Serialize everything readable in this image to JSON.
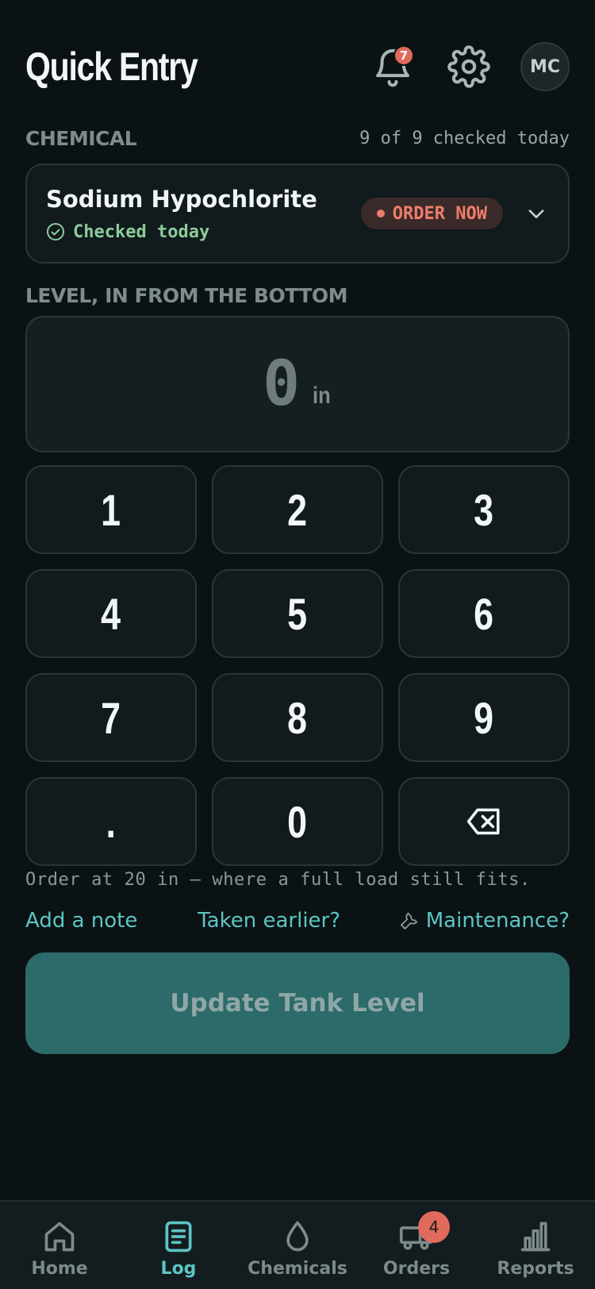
{
  "header": {
    "title": "Quick Entry",
    "notifications_count": "7",
    "avatar_initials": "MC",
    "icons": [
      "bell-icon",
      "gear-icon"
    ]
  },
  "chemical_section": {
    "label": "CHEMICAL",
    "checked_summary": "9 of 9 checked today",
    "selected": {
      "name": "Sodium Hypochlorite",
      "status": "Checked today",
      "order_badge": "ORDER NOW"
    }
  },
  "level_section": {
    "label": "LEVEL, IN FROM THE BOTTOM",
    "value": "0",
    "unit": "in"
  },
  "keypad": {
    "keys": [
      "1",
      "2",
      "3",
      "4",
      "5",
      "6",
      "7",
      "8",
      "9",
      ".",
      "0"
    ],
    "backspace_icon": "backspace-icon"
  },
  "hint": "Order at 20 in — where a full load still fits.",
  "links": {
    "add_note": "Add a note",
    "taken_earlier": "Taken earlier?",
    "maintenance": "Maintenance?"
  },
  "cta": {
    "label": "Update Tank Level"
  },
  "tabbar": {
    "tabs": [
      {
        "label": "Home",
        "icon": "home-icon"
      },
      {
        "label": "Log",
        "icon": "log-icon",
        "active": true
      },
      {
        "label": "Chemicals",
        "icon": "drop-icon"
      },
      {
        "label": "Orders",
        "icon": "truck-icon",
        "badge": "4"
      },
      {
        "label": "Reports",
        "icon": "bar-chart-icon"
      }
    ]
  },
  "colors": {
    "background": "#0b1214",
    "accent": "#5dc5c4",
    "alert": "#ee7d6c",
    "success": "#8ccc9a",
    "cta_disabled": "#2d6a6a"
  }
}
